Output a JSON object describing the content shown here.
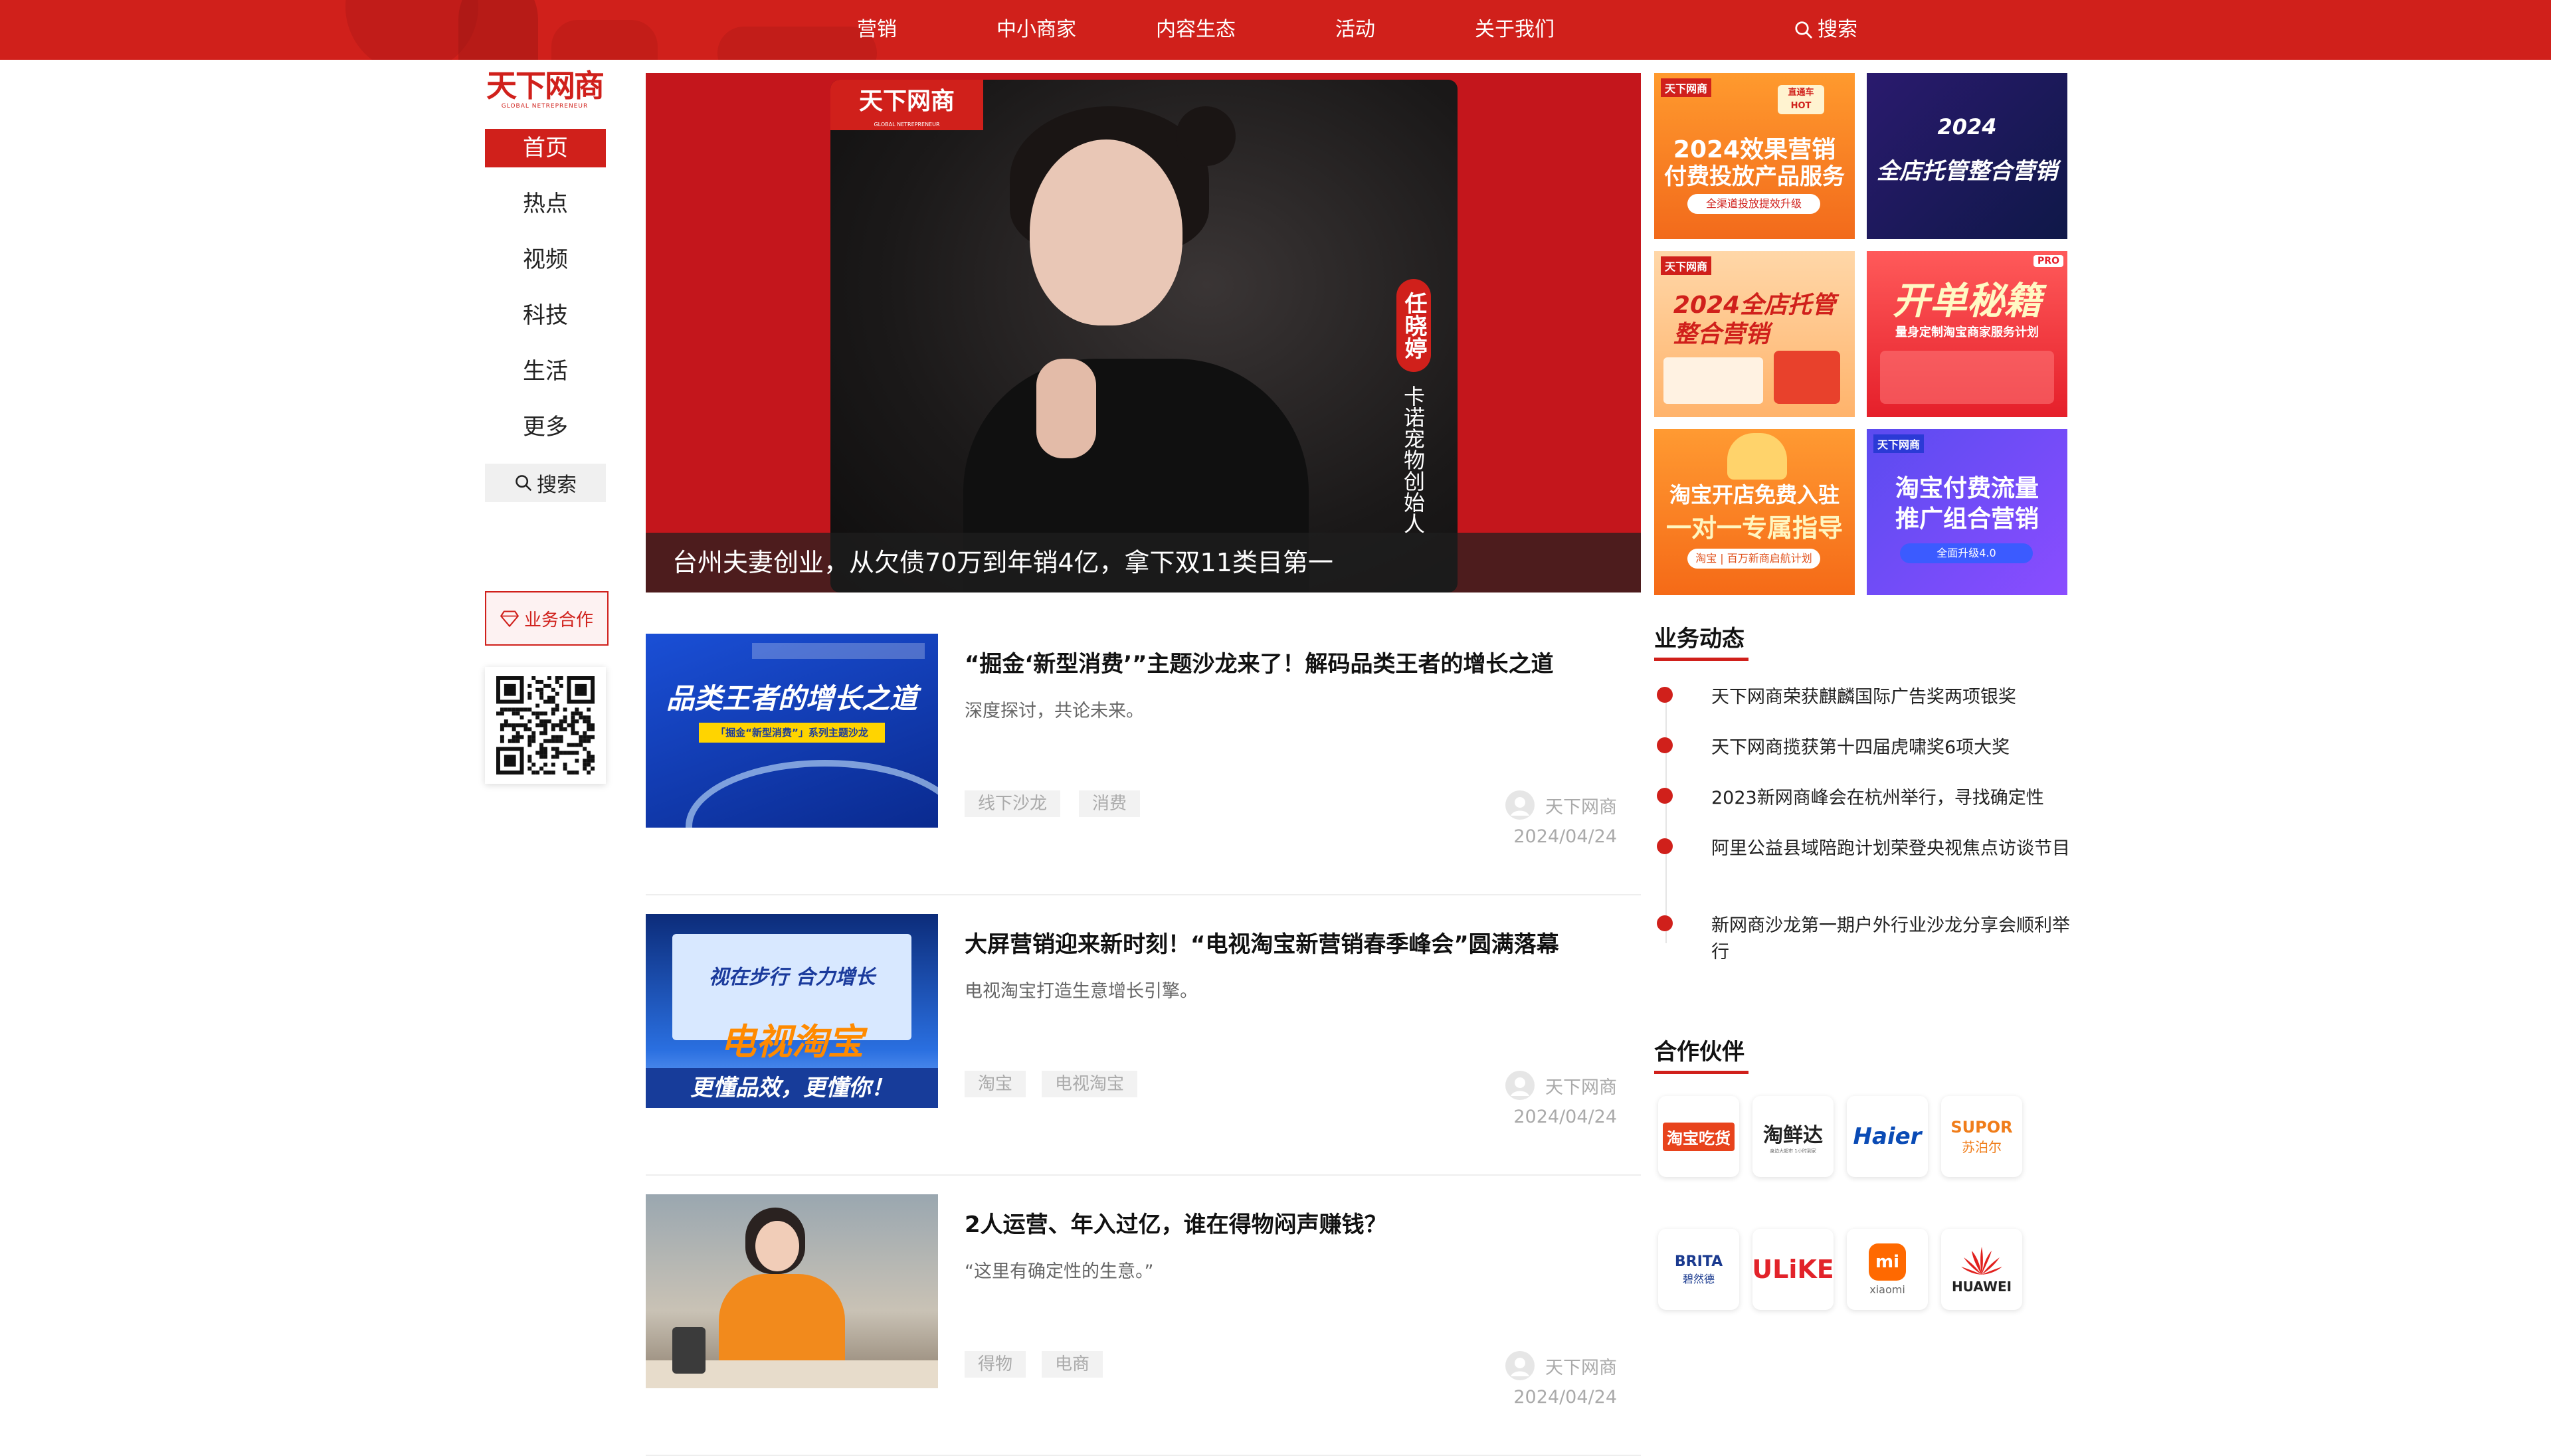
{
  "topnav": {
    "items": [
      "营销",
      "中小商家",
      "内容生态",
      "活动",
      "关于我们"
    ],
    "search_label": "搜索"
  },
  "brand": {
    "logo_text": "天下网商",
    "logo_sub": "GLOBAL NETREPRENEUR"
  },
  "sidebar": {
    "items": [
      "首页",
      "热点",
      "视频",
      "科技",
      "生活",
      "更多"
    ],
    "active_index": 0,
    "search_label": "搜索",
    "biz_button_label": "业务合作"
  },
  "hero": {
    "caption": "台州夫妻创业，从欠债70万到年销4亿，拿下双11类目第一",
    "logo_text": "天下网商",
    "logo_sub": "GLOBAL NETREPRENEUR",
    "name_tag": "任晓婷",
    "role": "卡诺宠物创始人"
  },
  "ads": [
    {
      "brand": "天下网商",
      "badge": "直通车 HOT",
      "line1": "2024效果营销",
      "line2": "付费投放产品服务",
      "pill": "全渠道投放提效升级"
    },
    {
      "year": "2024",
      "line1": "全店托管整合营销"
    },
    {
      "brand": "天下网商",
      "line1": "2024全店托管",
      "line2": "整合营销"
    },
    {
      "badge": "PRO",
      "line1": "开单秘籍",
      "line2": "量身定制淘宝商家服务计划"
    },
    {
      "line1": "淘宝开店免费入驻",
      "line2": "一对一专属指导",
      "pill": "淘宝 | 百万新商启航计划"
    },
    {
      "brand": "天下网商",
      "line1": "淘宝付费流量",
      "line2": "推广组合营销",
      "pill": "全面升级4.0"
    }
  ],
  "articles": [
    {
      "title": "“掘金‘新型消费’”主题沙龙来了！解码品类王者的增长之道",
      "desc": "深度探讨，共论未来。",
      "tags": [
        "线下沙龙",
        "消费"
      ],
      "author": "天下网商",
      "date": "2024/04/24",
      "thumb_text": "品类王者的增长之道",
      "thumb_sub": "「掘金“新型消费”」系列主题沙龙"
    },
    {
      "title": "大屏营销迎来新时刻！“电视淘宝新营销春季峰会”圆满落幕",
      "desc": "电视淘宝打造生意增长引擎。",
      "tags": [
        "淘宝",
        "电视淘宝"
      ],
      "author": "天下网商",
      "date": "2024/04/24",
      "thumb_text": "电视淘宝",
      "thumb_sub": "更懂品效，更懂你！",
      "thumb_top": "视在步行 合力增长"
    },
    {
      "title": "2人运营、年入过亿，谁在得物闷声赚钱？",
      "desc": "“这里有确定性的生意。”",
      "tags": [
        "得物",
        "电商"
      ],
      "author": "天下网商",
      "date": "2024/04/24"
    }
  ],
  "business_news": {
    "title": "业务动态",
    "items": [
      "天下网商荣获麒麟国际广告奖两项银奖",
      "天下网商揽获第十四届虎啸奖6项大奖",
      "2023新网商峰会在杭州举行，寻找确定性",
      "阿里公益县域陪跑计划荣登央视焦点访谈节目",
      "新网商沙龙第一期户外行业沙龙分享会顺利举行"
    ]
  },
  "partners": {
    "title": "合作伙伴",
    "items": [
      {
        "name": "淘宝吃货",
        "sub": ""
      },
      {
        "name": "淘鲜达",
        "sub": "身边大超市 1小时到家"
      },
      {
        "name": "Haier",
        "sub": ""
      },
      {
        "name": "SUPOR",
        "sub": "苏泊尔"
      },
      {
        "name": "BRITA",
        "sub": "碧然德"
      },
      {
        "name": "ULiKE",
        "sub": ""
      },
      {
        "name": "mi",
        "sub": "xiaomi"
      },
      {
        "name": "HUAWEI",
        "sub": ""
      }
    ]
  },
  "colors": {
    "brand_red": "#d0201b",
    "muted_text": "#aaaaaa"
  }
}
